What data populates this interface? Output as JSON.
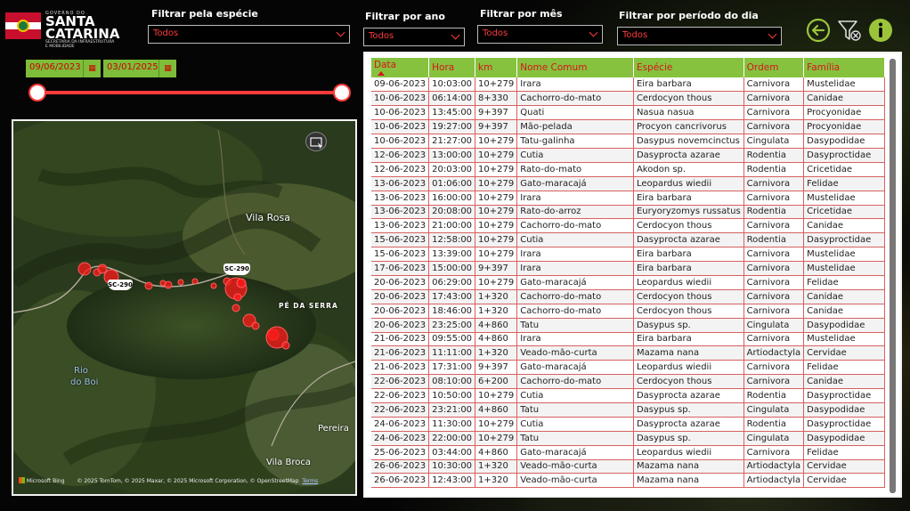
{
  "logo": {
    "line1": "GOVERNO DO",
    "line2a": "SANTA",
    "line2b": "CATARINA",
    "line3": "SECRETARIA DA INFRAESTRUTURA E MOBILIDADE"
  },
  "filters": {
    "species": {
      "label": "Filtrar pela espécie",
      "value": "Todos"
    },
    "year": {
      "label": "Filtrar por ano",
      "value": "Todos"
    },
    "month": {
      "label": "Filtrar por mês",
      "value": "Todos"
    },
    "period": {
      "label": "Filtrar por período do dia",
      "value": "Todos"
    }
  },
  "dates": {
    "start": "09/06/2023",
    "end": "03/01/2025"
  },
  "slider": {
    "start_fraction": 0,
    "end_fraction": 1
  },
  "map": {
    "places": {
      "vila_rosa": "Vila Rosa",
      "pe_da_serra": "PÉ DA SERRA",
      "rio": "Rio",
      "do_boi": "do Boi",
      "pereira": "Pereira",
      "vila_broca": "Vila Broca"
    },
    "road1": "SC-290",
    "road2": "SC-290",
    "attribution_brand": "Microsoft Bing",
    "attribution": "© 2025 TomTom, © 2025 Maxar, © 2025 Microsoft Corporation, © OpenStreetMap",
    "terms": "Terms"
  },
  "colors": {
    "accent_red": "#ff3b3b",
    "header_green": "#86c23e",
    "icon_green": "#9bc43b"
  },
  "table": {
    "columns": [
      "Data",
      "Hora",
      "km",
      "Nome Comum",
      "Espécie",
      "Ordem",
      "Família"
    ],
    "rows": [
      [
        "09-06-2023",
        "10:03:00",
        "10+279",
        "Irara",
        "Eira barbara",
        "Carnivora",
        "Mustelidae"
      ],
      [
        "10-06-2023",
        "06:14:00",
        "8+330",
        "Cachorro-do-mato",
        "Cerdocyon thous",
        "Carnivora",
        "Canidae"
      ],
      [
        "10-06-2023",
        "13:45:00",
        "9+397",
        "Quati",
        "Nasua nasua",
        "Carnivora",
        "Procyonidae"
      ],
      [
        "10-06-2023",
        "19:27:00",
        "9+397",
        "Mão-pelada",
        "Procyon cancrivorus",
        "Carnivora",
        "Procyonidae"
      ],
      [
        "10-06-2023",
        "21:27:00",
        "10+279",
        "Tatu-galinha",
        "Dasypus novemcinctus",
        "Cingulata",
        "Dasypodidae"
      ],
      [
        "12-06-2023",
        "13:00:00",
        "10+279",
        "Cutia",
        "Dasyprocta azarae",
        "Rodentia",
        "Dasyproctidae"
      ],
      [
        "12-06-2023",
        "20:03:00",
        "10+279",
        "Rato-do-mato",
        "Akodon sp.",
        "Rodentia",
        "Cricetidae"
      ],
      [
        "13-06-2023",
        "01:06:00",
        "10+279",
        "Gato-maracajá",
        "Leopardus wiedii",
        "Carnivora",
        "Felidae"
      ],
      [
        "13-06-2023",
        "16:00:00",
        "10+279",
        "Irara",
        "Eira barbara",
        "Carnivora",
        "Mustelidae"
      ],
      [
        "13-06-2023",
        "20:08:00",
        "10+279",
        "Rato-do-arroz",
        "Euryoryzomys russatus",
        "Rodentia",
        "Cricetidae"
      ],
      [
        "13-06-2023",
        "21:00:00",
        "10+279",
        "Cachorro-do-mato",
        "Cerdocyon thous",
        "Carnivora",
        "Canidae"
      ],
      [
        "15-06-2023",
        "12:58:00",
        "10+279",
        "Cutia",
        "Dasyprocta azarae",
        "Rodentia",
        "Dasyproctidae"
      ],
      [
        "15-06-2023",
        "13:39:00",
        "10+279",
        "Irara",
        "Eira barbara",
        "Carnivora",
        "Mustelidae"
      ],
      [
        "17-06-2023",
        "15:00:00",
        "9+397",
        "Irara",
        "Eira barbara",
        "Carnivora",
        "Mustelidae"
      ],
      [
        "20-06-2023",
        "06:29:00",
        "10+279",
        "Gato-maracajá",
        "Leopardus wiedii",
        "Carnivora",
        "Felidae"
      ],
      [
        "20-06-2023",
        "17:43:00",
        "1+320",
        "Cachorro-do-mato",
        "Cerdocyon thous",
        "Carnivora",
        "Canidae"
      ],
      [
        "20-06-2023",
        "18:46:00",
        "1+320",
        "Cachorro-do-mato",
        "Cerdocyon thous",
        "Carnivora",
        "Canidae"
      ],
      [
        "20-06-2023",
        "23:25:00",
        "4+860",
        "Tatu",
        "Dasypus sp.",
        "Cingulata",
        "Dasypodidae"
      ],
      [
        "21-06-2023",
        "09:55:00",
        "4+860",
        "Irara",
        "Eira barbara",
        "Carnivora",
        "Mustelidae"
      ],
      [
        "21-06-2023",
        "11:11:00",
        "1+320",
        "Veado-mão-curta",
        "Mazama nana",
        "Artiodactyla",
        "Cervidae"
      ],
      [
        "21-06-2023",
        "17:31:00",
        "9+397",
        "Gato-maracajá",
        "Leopardus wiedii",
        "Carnivora",
        "Felidae"
      ],
      [
        "22-06-2023",
        "08:10:00",
        "6+200",
        "Cachorro-do-mato",
        "Cerdocyon thous",
        "Carnivora",
        "Canidae"
      ],
      [
        "22-06-2023",
        "10:50:00",
        "10+279",
        "Cutia",
        "Dasyprocta azarae",
        "Rodentia",
        "Dasyproctidae"
      ],
      [
        "22-06-2023",
        "23:21:00",
        "4+860",
        "Tatu",
        "Dasypus sp.",
        "Cingulata",
        "Dasypodidae"
      ],
      [
        "24-06-2023",
        "11:30:00",
        "10+279",
        "Cutia",
        "Dasyprocta azarae",
        "Rodentia",
        "Dasyproctidae"
      ],
      [
        "24-06-2023",
        "22:00:00",
        "10+279",
        "Tatu",
        "Dasypus sp.",
        "Cingulata",
        "Dasypodidae"
      ],
      [
        "25-06-2023",
        "03:44:00",
        "4+860",
        "Gato-maracajá",
        "Leopardus wiedii",
        "Carnivora",
        "Felidae"
      ],
      [
        "26-06-2023",
        "10:30:00",
        "1+320",
        "Veado-mão-curta",
        "Mazama nana",
        "Artiodactyla",
        "Cervidae"
      ],
      [
        "26-06-2023",
        "12:43:00",
        "1+320",
        "Veado-mão-curta",
        "Mazama nana",
        "Artiodactyla",
        "Cervidae"
      ]
    ]
  }
}
